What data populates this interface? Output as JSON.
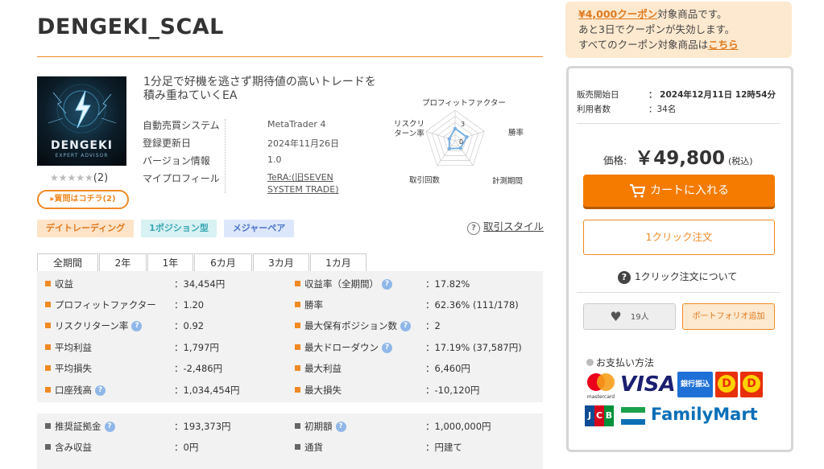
{
  "product": {
    "title": "DENGEKI_SCAL",
    "thumbnail_brand": "DENGEKI",
    "thumbnail_sub": "EXPERT ADVISOR",
    "stars": "★★★★★",
    "review_count": "(2)",
    "question_button": "質問はコチラ(2)",
    "description": "1分足で好機を逃さず期待値の高いトレードを積み重ねていくEA",
    "specs": [
      {
        "label": "自動売買システム",
        "value": "MetaTrader 4"
      },
      {
        "label": "登録更新日",
        "value": "2024年11月26日"
      },
      {
        "label": "バージョン情報",
        "value": "1.0"
      },
      {
        "label": "マイプロフィール",
        "value": "TeRA:(旧SEVEN SYSTEM TRADE)"
      }
    ]
  },
  "radar": {
    "labels": [
      "プロフィットファクター",
      "勝率",
      "計測期間",
      "取引回数",
      "リスクリターン率"
    ],
    "scale_labels": [
      "3",
      "0"
    ],
    "values": [
      2.0,
      2.0,
      1.5,
      1.6,
      1.0
    ],
    "max": 5,
    "line_color": "#7ab0e0"
  },
  "tags": [
    "デイトレーディング",
    "1ポジション型",
    "メジャーペア"
  ],
  "trade_style_link": "取引スタイル",
  "period_tabs": [
    "全期間",
    "2年",
    "1年",
    "6カ月",
    "3カ月",
    "1カ月"
  ],
  "stats_left": [
    {
      "label": "収益",
      "value": "：34,454円",
      "help": false
    },
    {
      "label": "プロフィットファクター",
      "value": "：1.20",
      "help": false
    },
    {
      "label": "リスクリターン率",
      "value": "：0.92",
      "help": true
    },
    {
      "label": "平均利益",
      "value": "：1,797円",
      "help": false
    },
    {
      "label": "平均損失",
      "value": "：-2,486円",
      "help": false
    },
    {
      "label": "口座残高",
      "value": "：1,034,454円",
      "help": true
    }
  ],
  "stats_right": [
    {
      "label": "収益率（全期間）",
      "value": "：17.82%",
      "help": true
    },
    {
      "label": "勝率",
      "value": "：62.36% (111/178)",
      "help": false
    },
    {
      "label": "最大保有ポジション数",
      "value": "：2",
      "help": true
    },
    {
      "label": "最大ドローダウン",
      "value": "：17.19% (37,587円)",
      "help": true
    },
    {
      "label": "最大利益",
      "value": "：6,460円",
      "help": false
    },
    {
      "label": "最大損失",
      "value": "：-10,120円",
      "help": false
    }
  ],
  "stats2_left": [
    {
      "label": "推奨証拠金",
      "value": "：193,373円",
      "help": true
    },
    {
      "label": "含み収益",
      "value": "：0円",
      "help": false
    }
  ],
  "stats2_right": [
    {
      "label": "初期額",
      "value": "：1,000,000円",
      "help": true
    },
    {
      "label": "通貨",
      "value": "：円建て",
      "help": false
    }
  ],
  "coupon": {
    "link": "¥4,000クーポン",
    "line1_rest": "対象商品です。",
    "line2": "あと3日でクーポンが失効します。",
    "line3_pre": "すべてのクーポン対象商品は",
    "line3_link": "こちら"
  },
  "sale": {
    "start_label": "販売開始日",
    "start_value": "：  2024年12月11日 12時54分",
    "users_label": "利用者数",
    "users_value": "：34名",
    "price_label": "価格:",
    "price": "￥49,800",
    "tax": "(税込)",
    "cart_button": "カートに入れる",
    "oneclick_button": "1クリック注文",
    "oneclick_about": "1クリック注文について",
    "likes": "19人",
    "portfolio_button": "ポートフォリオ追加",
    "payment_title": "お支払い方法",
    "payment_methods": {
      "mastercard": "mastercard",
      "visa": "VISA",
      "bank": "銀行振込",
      "daily": "Daily",
      "jcb": "JCB",
      "familymart": "FamilyMart"
    }
  }
}
